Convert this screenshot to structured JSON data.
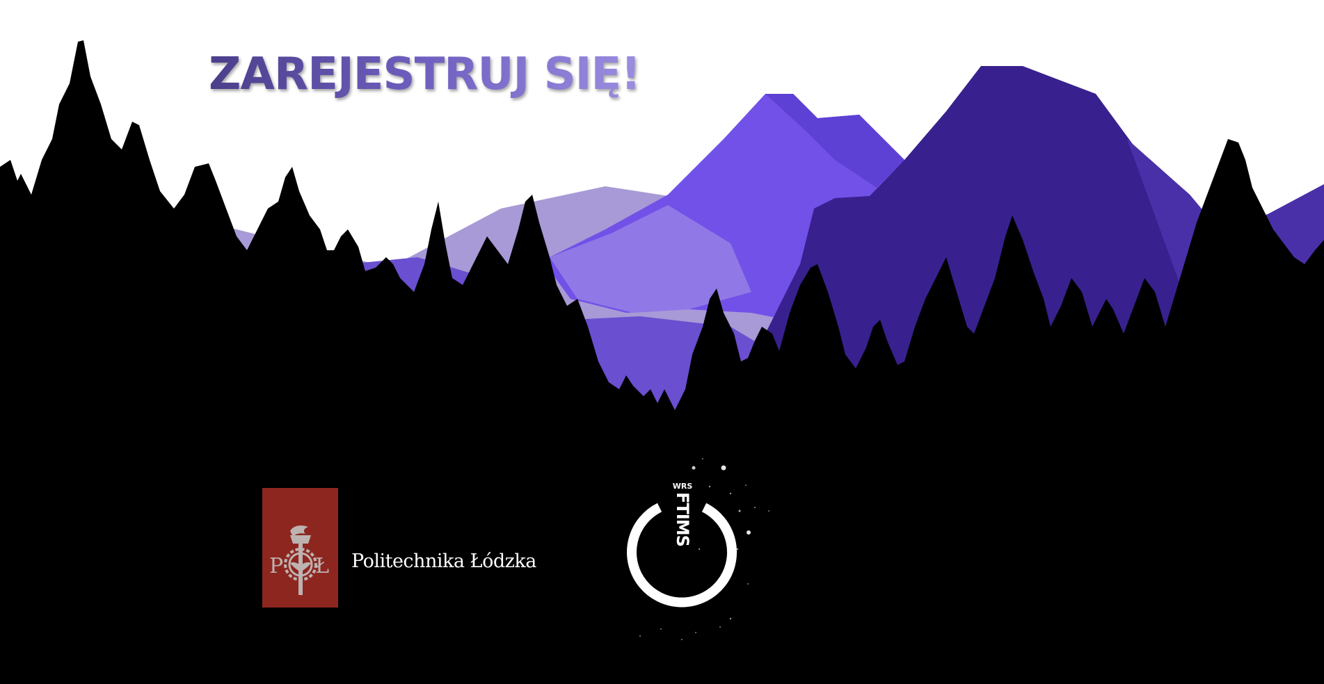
{
  "headline": {
    "text": "ZAREJESTRUJ SIĘ!",
    "gradient_colors": [
      "#4a3f8a",
      "#6f5fc0",
      "#9a8ee0"
    ]
  },
  "scene": {
    "description_icon": "mountain-forest-illustration",
    "sky_color": "#ffffff",
    "mountain_colors": [
      "#a08ed8",
      "#7553e6",
      "#5a3fc4",
      "#3d2490"
    ],
    "forest_color": "#000000"
  },
  "university_logo": {
    "icon": "pl-emblem-icon",
    "box_color": "#8e2620",
    "emblem_letters": "PŁ",
    "name": "Politechnika Łódzka"
  },
  "faculty_logo": {
    "icon": "ftims-power-icon",
    "small_text": "WRS",
    "main_text": "FTIMS"
  }
}
